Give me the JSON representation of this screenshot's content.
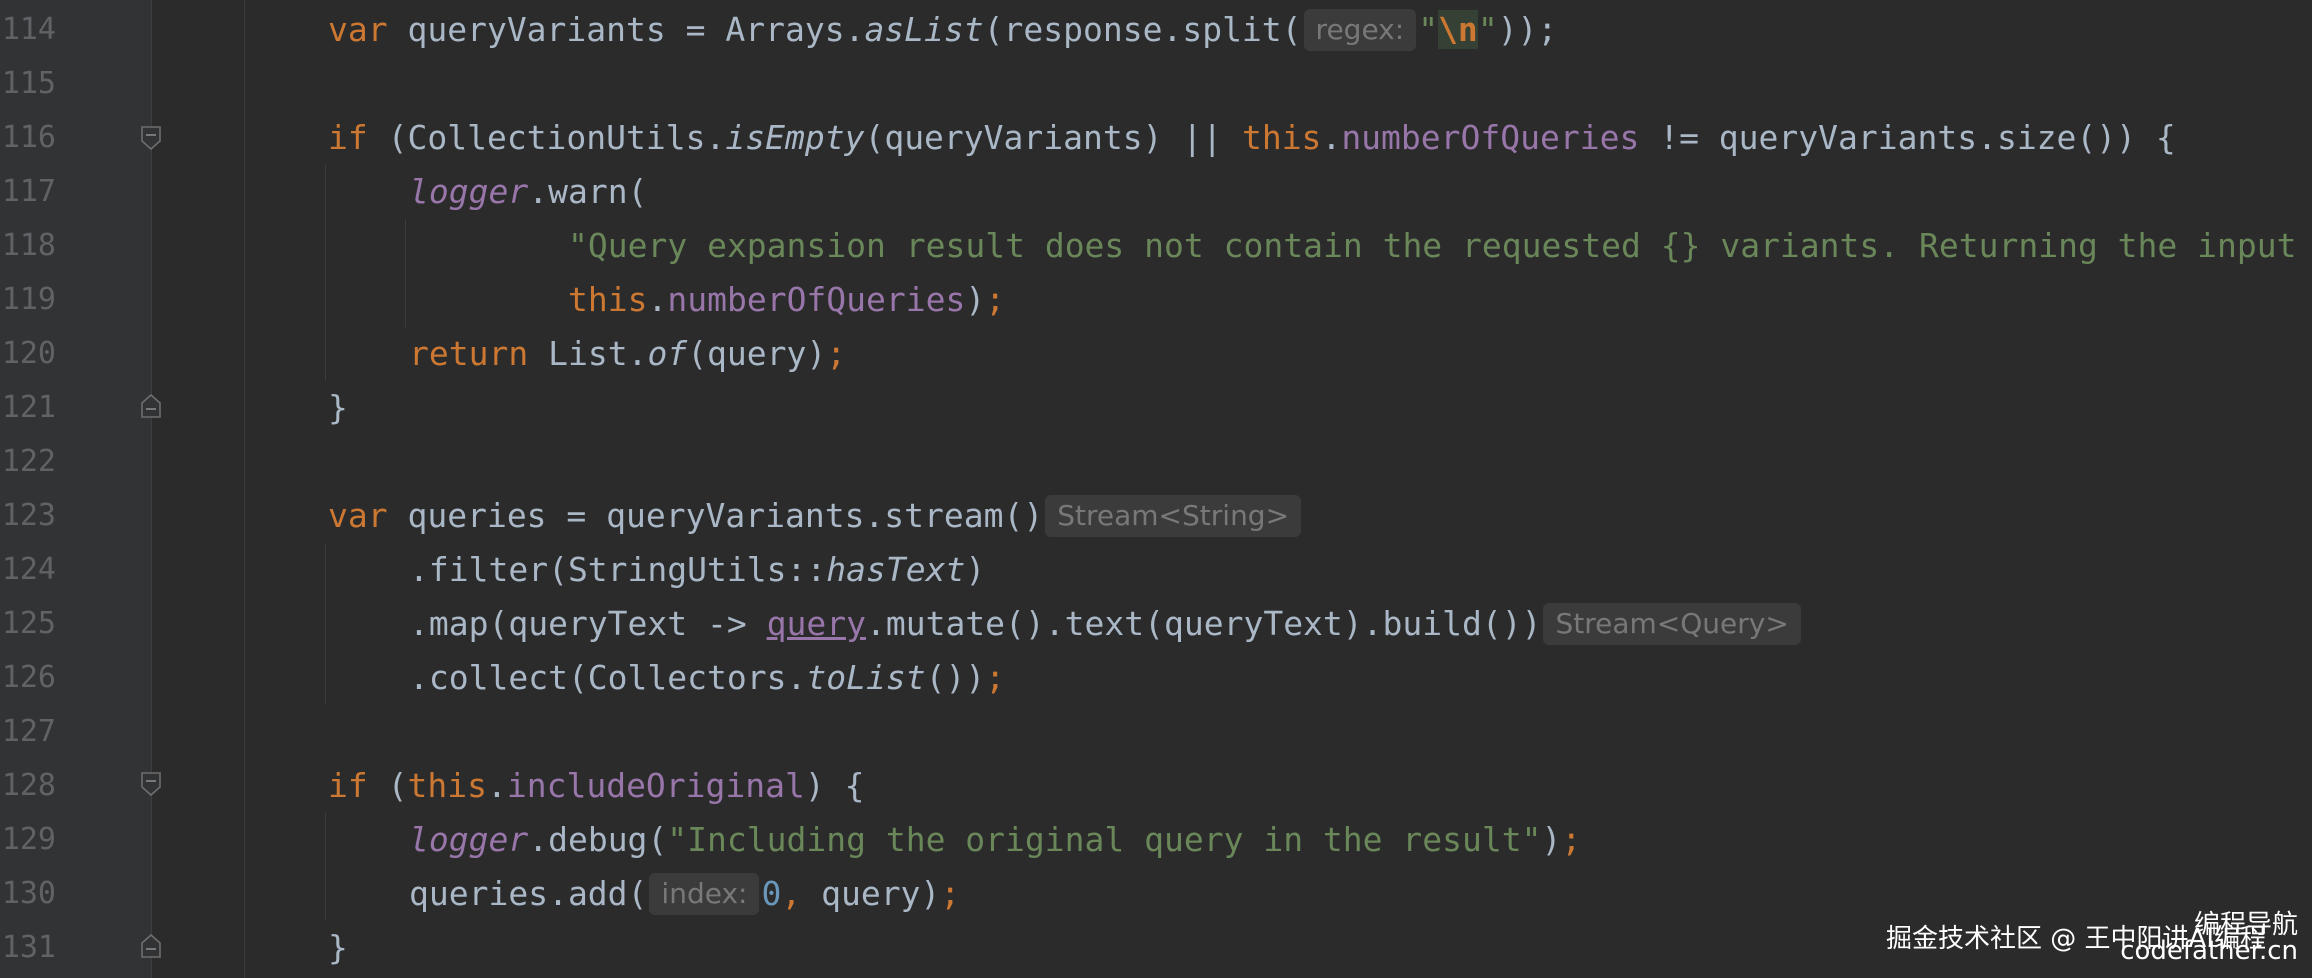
{
  "editor": {
    "colors": {
      "background": "#2b2b2b",
      "gutter": "#313335",
      "line_number": "#606366",
      "default_text": "#a9b7c6",
      "keyword": "#cc7832",
      "field": "#9876aa",
      "string": "#6a8759",
      "number": "#6897bb",
      "inlay_hint": "#787878"
    },
    "line_numbers": [
      "114",
      "115",
      "116",
      "117",
      "118",
      "119",
      "120",
      "121",
      "122",
      "123",
      "124",
      "125",
      "126",
      "127",
      "128",
      "129",
      "130",
      "131"
    ],
    "lines": {
      "l114": {
        "t1": "var",
        "t2": " queryVariants = Arrays.",
        "t3": "asList",
        "t4": "(response.split(",
        "hint_regex": "regex:",
        "t5": "\"",
        "t6": "\\n",
        "t7": "\"",
        "t8": "));"
      },
      "l116": {
        "t1": "if",
        "t2": " (CollectionUtils.",
        "t3": "isEmpty",
        "t4": "(queryVariants) || ",
        "t5": "this",
        "t6": ".",
        "t7": "numberOfQueries",
        "t8": " != queryVariants.size()) {"
      },
      "l117": {
        "t1": "logger",
        "t2": ".warn("
      },
      "l118": {
        "t1": "\"Query expansion result does not contain the requested {} variants. Returning the input"
      },
      "l119": {
        "t1": "this",
        "t2": ".",
        "t3": "numberOfQueries",
        "t4": ")",
        "t5": ";"
      },
      "l120": {
        "t1": "return",
        "t2": " List.",
        "t3": "of",
        "t4": "(query)",
        "t5": ";"
      },
      "l121": {
        "t1": "}"
      },
      "l123": {
        "t1": "var",
        "t2": " queries = queryVariants.stream()",
        "hint_type": "Stream<String>"
      },
      "l124": {
        "t1": ".filter(StringUtils::",
        "t2": "hasText",
        "t3": ")"
      },
      "l125": {
        "t1": ".map(queryText -> ",
        "t2": "query",
        "t3": ".mutate().text(queryText).build())",
        "hint_type": "Stream<Query>"
      },
      "l126": {
        "t1": ".collect(Collectors.",
        "t2": "toList",
        "t3": "())",
        "t4": ";"
      },
      "l128": {
        "t1": "if",
        "t2": " (",
        "t3": "this",
        "t4": ".",
        "t5": "includeOriginal",
        "t6": ") {"
      },
      "l129": {
        "t1": "logger",
        "t2": ".debug(",
        "t3": "\"Including the original query in the result\"",
        "t4": ")",
        "t5": ";"
      },
      "l130": {
        "t1": "queries.add(",
        "hint_index": "index:",
        "t2": "0",
        "t3": ",",
        "t4": " query)",
        "t5": ";"
      },
      "l131": {
        "t1": "}"
      }
    }
  },
  "watermark": {
    "line1": "编程导航",
    "line2": "掘金技术社区 @ 王中阳讲AI编程",
    "line3": "codefather.cn"
  }
}
